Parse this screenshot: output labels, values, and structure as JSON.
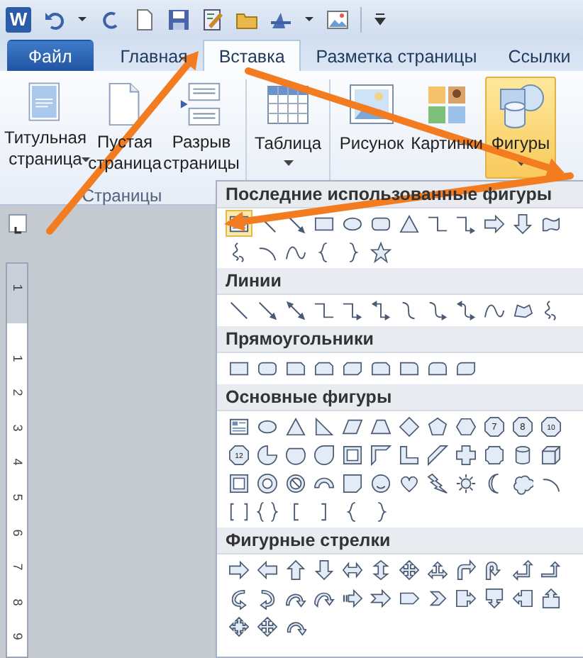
{
  "app": {
    "logo_letter": "W"
  },
  "tabs": [
    {
      "label": "Файл",
      "kind": "file",
      "selected": false
    },
    {
      "label": "Главная",
      "kind": "tab",
      "selected": false
    },
    {
      "label": "Вставка",
      "kind": "tab",
      "selected": true
    },
    {
      "label": "Разметка страницы",
      "kind": "tab",
      "selected": false
    },
    {
      "label": "Ссылки",
      "kind": "tab",
      "selected": false
    }
  ],
  "ribbon": {
    "groups": [
      {
        "label": "Страницы",
        "buttons": [
          {
            "label": "Титульная страница",
            "kind": "inline",
            "selected": false
          },
          {
            "label": "Пустая страница",
            "selected": false
          },
          {
            "label": "Разрыв страницы",
            "selected": false
          }
        ]
      },
      {
        "buttons": [
          {
            "label": "Таблица",
            "kind": "below",
            "selected": false
          }
        ]
      },
      {
        "buttons": [
          {
            "label": "Рисунок",
            "selected": false
          },
          {
            "label": "Картинки",
            "selected": false
          },
          {
            "label": "Фигуры",
            "kind": "below",
            "selected": true
          }
        ]
      }
    ]
  },
  "ruler_labels": [
    "1",
    "1",
    "2",
    "3",
    "4",
    "5",
    "6",
    "7",
    "8",
    "9"
  ],
  "shapes_gallery": {
    "sections": [
      {
        "title": "Последние использованные фигуры",
        "shapes": [
          {
            "kind": "textbox",
            "selected": true
          },
          {
            "kind": "line",
            "selected": false
          },
          {
            "kind": "arrowline",
            "selected": false
          },
          {
            "kind": "rect",
            "selected": false
          },
          {
            "kind": "oval",
            "selected": false
          },
          {
            "kind": "roundrect",
            "selected": false
          },
          {
            "kind": "triangle",
            "selected": false
          },
          {
            "kind": "elbow",
            "selected": false
          },
          {
            "kind": "elbowarrow",
            "selected": false
          },
          {
            "kind": "rarrow",
            "selected": false
          },
          {
            "kind": "darrow",
            "selected": false
          },
          {
            "kind": "wave",
            "selected": false
          },
          {
            "kind": "scribble",
            "selected": false
          },
          {
            "kind": "arc",
            "selected": false
          },
          {
            "kind": "curve",
            "selected": false
          },
          {
            "kind": "lbrace",
            "selected": false
          },
          {
            "kind": "rbrace",
            "selected": false
          },
          {
            "kind": "star",
            "selected": false
          }
        ]
      },
      {
        "title": "Линии",
        "shapes": [
          {
            "kind": "line"
          },
          {
            "kind": "arrowline"
          },
          {
            "kind": "dblarrow"
          },
          {
            "kind": "elbow"
          },
          {
            "kind": "elbowarrow"
          },
          {
            "kind": "elbowdouble"
          },
          {
            "kind": "scurve"
          },
          {
            "kind": "scurvearrow"
          },
          {
            "kind": "scurvedouble"
          },
          {
            "kind": "curve"
          },
          {
            "kind": "freeform"
          },
          {
            "kind": "scribble"
          }
        ]
      },
      {
        "title": "Прямоугольники",
        "shapes": [
          {
            "kind": "rect"
          },
          {
            "kind": "roundrect"
          },
          {
            "kind": "snip1"
          },
          {
            "kind": "snip2"
          },
          {
            "kind": "snipdiag"
          },
          {
            "kind": "sniprnd"
          },
          {
            "kind": "round1"
          },
          {
            "kind": "round2"
          },
          {
            "kind": "rounddiag"
          }
        ]
      },
      {
        "title": "Основные фигуры",
        "shapes": [
          {
            "kind": "textbox"
          },
          {
            "kind": "oval"
          },
          {
            "kind": "triangle"
          },
          {
            "kind": "rtriangle"
          },
          {
            "kind": "parallelogram"
          },
          {
            "kind": "trapezoid"
          },
          {
            "kind": "diamond"
          },
          {
            "kind": "pentagon"
          },
          {
            "kind": "hexagon"
          },
          {
            "kind": "polygon",
            "label": "7"
          },
          {
            "kind": "polygon",
            "label": "8"
          },
          {
            "kind": "polygon",
            "label": "10"
          },
          {
            "kind": "polygon",
            "label": "12"
          },
          {
            "kind": "pie"
          },
          {
            "kind": "chord"
          },
          {
            "kind": "teardrop"
          },
          {
            "kind": "frame"
          },
          {
            "kind": "halfframe"
          },
          {
            "kind": "lshape"
          },
          {
            "kind": "diagstripe"
          },
          {
            "kind": "cross"
          },
          {
            "kind": "plaque"
          },
          {
            "kind": "can"
          },
          {
            "kind": "cube"
          },
          {
            "kind": "bevel"
          },
          {
            "kind": "donut"
          },
          {
            "kind": "nosymbol"
          },
          {
            "kind": "blockarc"
          },
          {
            "kind": "folded"
          },
          {
            "kind": "smiley"
          },
          {
            "kind": "heart"
          },
          {
            "kind": "lightning"
          },
          {
            "kind": "sun"
          },
          {
            "kind": "moon"
          },
          {
            "kind": "cloud"
          },
          {
            "kind": "arc"
          },
          {
            "kind": "bracketpair"
          },
          {
            "kind": "bracepair"
          },
          {
            "kind": "lbracket"
          },
          {
            "kind": "rbracket"
          },
          {
            "kind": "lbrace"
          },
          {
            "kind": "rbrace"
          }
        ]
      },
      {
        "title": "Фигурные стрелки",
        "shapes": [
          {
            "kind": "rarrow"
          },
          {
            "kind": "larrow"
          },
          {
            "kind": "uarrow"
          },
          {
            "kind": "darrow"
          },
          {
            "kind": "lrarrow"
          },
          {
            "kind": "udarrow"
          },
          {
            "kind": "quadarrow"
          },
          {
            "kind": "lruarrow"
          },
          {
            "kind": "bentarrow"
          },
          {
            "kind": "uturn"
          },
          {
            "kind": "leftup"
          },
          {
            "kind": "bentup"
          },
          {
            "kind": "curvedright"
          },
          {
            "kind": "curvedleft"
          },
          {
            "kind": "curvedup"
          },
          {
            "kind": "curveddown"
          },
          {
            "kind": "striped"
          },
          {
            "kind": "notched"
          },
          {
            "kind": "homeplate"
          },
          {
            "kind": "chevron"
          },
          {
            "kind": "rcallout"
          },
          {
            "kind": "dcallout"
          },
          {
            "kind": "lcallout"
          },
          {
            "kind": "ucallout"
          },
          {
            "kind": "quadcallout"
          },
          {
            "kind": "quadarrow"
          },
          {
            "kind": "circular"
          }
        ]
      }
    ]
  }
}
